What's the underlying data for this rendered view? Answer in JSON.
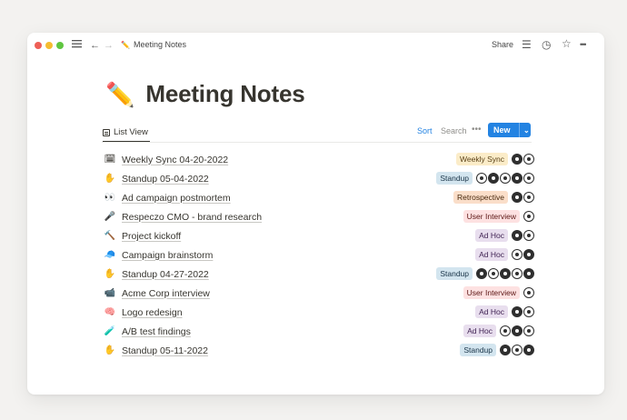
{
  "window": {
    "controls": {
      "colors": [
        "#ee5f56",
        "#f5bc30",
        "#5fc640"
      ]
    },
    "menu_icon": "hamburger-icon",
    "back_glyph": "←",
    "forward_glyph": "→",
    "breadcrumb": {
      "icon": "✏️",
      "label": "Meeting Notes"
    },
    "share_label": "Share",
    "comment_glyph": "☰",
    "history_glyph": "◷",
    "favorite_glyph": "☆",
    "more_glyph": "•••"
  },
  "page": {
    "icon": "✏️",
    "title": "Meeting Notes"
  },
  "view": {
    "tab_label": "List View",
    "sort_label": "Sort",
    "search_label": "Search",
    "more_label": "•••",
    "new_label": "New",
    "new_chevron": "⌄"
  },
  "tag_colors": {
    "Weekly Sync": {
      "bg": "#fbecc8",
      "fg": "#5c4319"
    },
    "Standup": {
      "bg": "#d3e5ef",
      "fg": "#183347"
    },
    "Retrospective": {
      "bg": "#fadec9",
      "fg": "#49290e"
    },
    "User Interview": {
      "bg": "#fde1e1",
      "fg": "#5d1715"
    },
    "Ad Hoc": {
      "bg": "#e8deee",
      "fg": "#412454"
    }
  },
  "rows": [
    {
      "icon": "🗓",
      "title": "Weekly Sync 04-20-2022",
      "tag": "Weekly Sync",
      "avatars": 2
    },
    {
      "icon": "✋",
      "title": "Standup 05-04-2022",
      "tag": "Standup",
      "avatars": 5
    },
    {
      "icon": "👀",
      "title": "Ad campaign postmortem",
      "tag": "Retrospective",
      "avatars": 2
    },
    {
      "icon": "🎤",
      "title": "Respeczo CMO - brand research",
      "tag": "User Interview",
      "avatars": 1
    },
    {
      "icon": "🔨",
      "title": "Project kickoff",
      "tag": "Ad Hoc",
      "avatars": 2
    },
    {
      "icon": "🧢",
      "title": "Campaign brainstorm",
      "tag": "Ad Hoc",
      "avatars": 2
    },
    {
      "icon": "✋",
      "title": "Standup 04-27-2022",
      "tag": "Standup",
      "avatars": 5
    },
    {
      "icon": "📹",
      "title": "Acme Corp interview",
      "tag": "User Interview",
      "avatars": 1
    },
    {
      "icon": "🧠",
      "title": "Logo redesign",
      "tag": "Ad Hoc",
      "avatars": 2
    },
    {
      "icon": "🧪",
      "title": "A/B test findings",
      "tag": "Ad Hoc",
      "avatars": 3
    },
    {
      "icon": "✋",
      "title": "Standup 05-11-2022",
      "tag": "Standup",
      "avatars": 3
    }
  ]
}
